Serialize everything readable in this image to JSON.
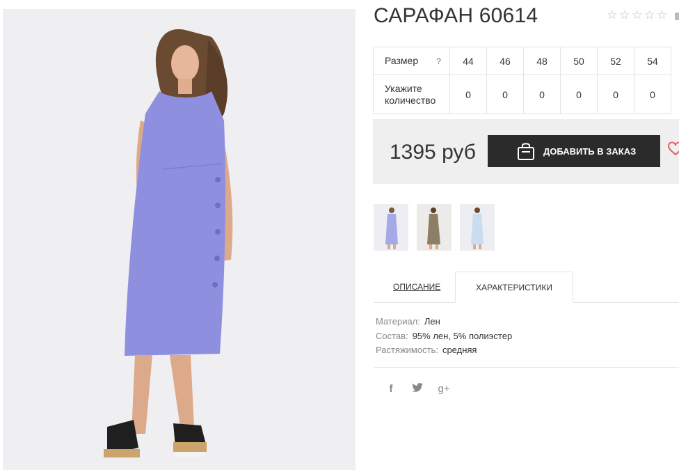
{
  "product": {
    "title": "САРАФАН 60614",
    "rating_stars": 5
  },
  "size_table": {
    "size_label": "Размер",
    "help": "?",
    "sizes": [
      "44",
      "46",
      "48",
      "50",
      "52",
      "54"
    ],
    "qty_label": "Укажите количество",
    "quantities": [
      "0",
      "0",
      "0",
      "0",
      "0",
      "0"
    ]
  },
  "purchase": {
    "price": "1395 руб",
    "add_label": "ДОБАВИТЬ В ЗАКАЗ"
  },
  "thumbnails": [
    {
      "color": "#a5a9e6"
    },
    {
      "color": "#8d7e66"
    },
    {
      "color": "#c9dcf0"
    }
  ],
  "tabs": {
    "description": "ОПИСАНИЕ",
    "characteristics": "ХАРАКТЕРИСТИКИ"
  },
  "specs": [
    {
      "key": "Материал:",
      "value": "Лен"
    },
    {
      "key": "Состав:",
      "value": "95% лен, 5% полиэстер"
    },
    {
      "key": "Растяжимость:",
      "value": "средняя"
    }
  ],
  "social": {
    "facebook": "f",
    "twitter": "twitter-icon",
    "google_plus": "g+"
  },
  "colors": {
    "dress": "#8f8fe0",
    "button": "#2b2b2b",
    "heart": "#e0606a"
  }
}
